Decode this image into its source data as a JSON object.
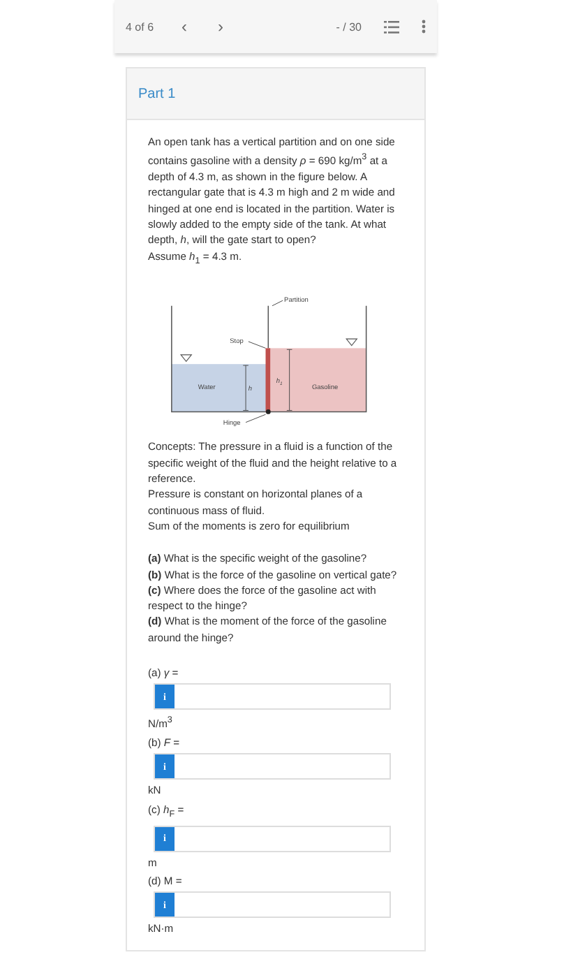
{
  "toolbar": {
    "position": "4 of 6",
    "prev": "‹",
    "next": "›",
    "score": "- / 30"
  },
  "part": {
    "title": "Part 1"
  },
  "problem": "An open tank has a vertical partition and on one side contains gasoline with a density *ρ* = 690 kg/m$^{3}$ at a depth of 4.3 m, as shown in the figure below. A rectangular gate that is 4.3 m high and 2 m wide and hinged at one end is located in the partition. Water is slowly added to the empty side of the tank. At what depth, *h*, will the gate start to open?",
  "assumption": "Assume *h*$_{1}$ = 4.3 m.",
  "figure": {
    "partition": "Partition",
    "stop": "Stop",
    "water": "Water",
    "h": "h",
    "h1": "h",
    "h1_sub": "1",
    "gasoline": "Gasoline",
    "hinge": "Hinge"
  },
  "concepts": [
    "Concepts: The pressure in a fluid is a function of the specific weight of the fluid and the height relative to a reference.",
    "Pressure is constant on horizontal planes of a continuous mass of fluid.",
    "Sum of the moments is zero for equilibrium"
  ],
  "questions": [
    "**(a)** What is the specific weight of the gasoline?",
    "**(b)** What is the force of the gasoline on vertical gate?",
    "**(c)** Where does the force of the gasoline act with respect to the hinge?",
    "**(d)** What is the moment of the force of the gasoline around the hinge?"
  ],
  "answers": [
    {
      "label": "(a) *γ* =",
      "hint": "i",
      "unit": "N/m$^{3}$"
    },
    {
      "label": "(b) *F* =",
      "hint": "i",
      "unit": "kN"
    },
    {
      "label": "(c) *h*$_{F}$ =",
      "hint": "i",
      "unit": "m"
    },
    {
      "label": "(d) M =",
      "hint": "i",
      "unit": "kN·m"
    }
  ]
}
